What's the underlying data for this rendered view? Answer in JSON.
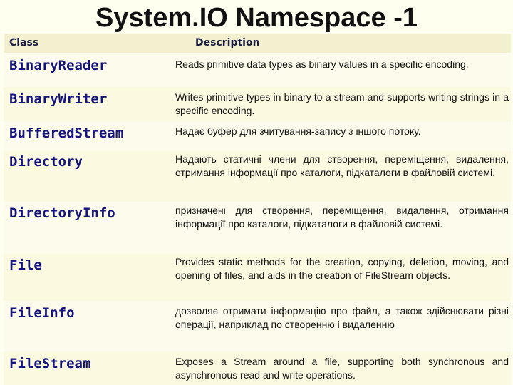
{
  "slide": {
    "title": "System.IO Namespace -1"
  },
  "table": {
    "headers": {
      "class": "Class",
      "description": "Description"
    },
    "rows": [
      {
        "class": "BinaryReader",
        "description": "Reads primitive data types as binary values in a specific encoding."
      },
      {
        "class": "BinaryWriter",
        "description": "Writes primitive types in binary to a stream and supports writing strings in a specific encoding."
      },
      {
        "class": "BufferedStream",
        "description": "Надає буфер для зчитування-запису з іншого потоку."
      },
      {
        "class": "Directory",
        "description": "Надають статичні члени для створення, переміщення, видалення, отримання інформації про каталоги, підкаталоги в файловій системі."
      },
      {
        "class": "DirectoryInfo",
        "description": "призначені для створення, переміщення, видалення, отримання інформації про каталоги, підкаталоги в файловій системі."
      },
      {
        "class": "File",
        "description": "Provides static methods for the creation, copying, deletion, moving, and opening of files, and aids in the creation of FileStream objects."
      },
      {
        "class": "FileInfo",
        "description": "дозволяє отримати інформацію про файл, а також здійснювати різні операції, наприклад по створенню і видаленню"
      },
      {
        "class": "FileStream",
        "description": "Exposes a Stream around a file, supporting both synchronous and asynchronous read and write operations."
      }
    ]
  }
}
